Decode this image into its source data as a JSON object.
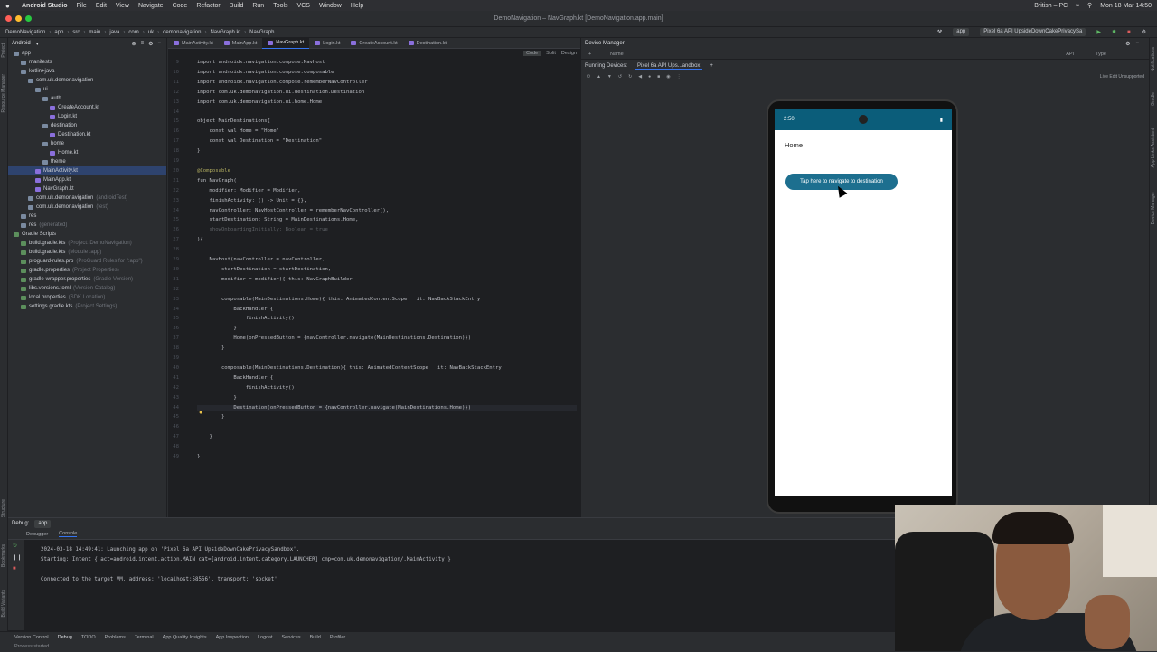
{
  "menubar": {
    "app_name": "Android Studio",
    "items": [
      "File",
      "Edit",
      "View",
      "Navigate",
      "Code",
      "Refactor",
      "Build",
      "Run",
      "Tools",
      "VCS",
      "Window",
      "Help"
    ],
    "input_source": "British – PC",
    "datetime": "Mon 18 Mar 14:50"
  },
  "window": {
    "title": "DemoNavigation – NavGraph.kt [DemoNavigation.app.main]"
  },
  "breadcrumb": [
    "DemoNavigation",
    "app",
    "src",
    "main",
    "java",
    "com",
    "uk",
    "demonavigation",
    "NavGraph.kt",
    "NavGraph"
  ],
  "run_config": {
    "module": "app",
    "device": "Pixel 6a API UpsideDownCakePrivacySa"
  },
  "project_panel": {
    "view_label": "Android",
    "tree": [
      {
        "label": "app",
        "indent": 0,
        "type": "folder"
      },
      {
        "label": "manifests",
        "indent": 1,
        "type": "folder"
      },
      {
        "label": "kotlin+java",
        "indent": 1,
        "type": "folder"
      },
      {
        "label": "com.uk.demonavigation",
        "indent": 2,
        "type": "folder"
      },
      {
        "label": "ui",
        "indent": 3,
        "type": "folder"
      },
      {
        "label": "auth",
        "indent": 4,
        "type": "folder"
      },
      {
        "label": "CreateAccount.kt",
        "indent": 5,
        "type": "kt"
      },
      {
        "label": "Login.kt",
        "indent": 5,
        "type": "kt"
      },
      {
        "label": "destination",
        "indent": 4,
        "type": "folder"
      },
      {
        "label": "Destination.kt",
        "indent": 5,
        "type": "kt"
      },
      {
        "label": "home",
        "indent": 4,
        "type": "folder"
      },
      {
        "label": "Home.kt",
        "indent": 5,
        "type": "kt"
      },
      {
        "label": "theme",
        "indent": 4,
        "type": "folder"
      },
      {
        "label": "MainActivity.kt",
        "indent": 3,
        "type": "kt",
        "selected": true
      },
      {
        "label": "MainApp.kt",
        "indent": 3,
        "type": "kt"
      },
      {
        "label": "NavGraph.kt",
        "indent": 3,
        "type": "kt"
      },
      {
        "label": "com.uk.demonavigation",
        "dim": "(androidTest)",
        "indent": 2,
        "type": "folder"
      },
      {
        "label": "com.uk.demonavigation",
        "dim": "(test)",
        "indent": 2,
        "type": "folder"
      },
      {
        "label": "res",
        "indent": 1,
        "type": "folder"
      },
      {
        "label": "res",
        "dim": "(generated)",
        "indent": 1,
        "type": "folder"
      },
      {
        "label": "Gradle Scripts",
        "indent": 0,
        "type": "gr"
      },
      {
        "label": "build.gradle.kts",
        "dim": "(Project: DemoNavigation)",
        "indent": 1,
        "type": "gr"
      },
      {
        "label": "build.gradle.kts",
        "dim": "(Module :app)",
        "indent": 1,
        "type": "gr"
      },
      {
        "label": "proguard-rules.pro",
        "dim": "(ProGuard Rules for \":app\")",
        "indent": 1,
        "type": "gr"
      },
      {
        "label": "gradle.properties",
        "dim": "(Project Properties)",
        "indent": 1,
        "type": "gr"
      },
      {
        "label": "gradle-wrapper.properties",
        "dim": "(Gradle Version)",
        "indent": 1,
        "type": "gr"
      },
      {
        "label": "libs.versions.toml",
        "dim": "(Version Catalog)",
        "indent": 1,
        "type": "gr"
      },
      {
        "label": "local.properties",
        "dim": "(SDK Location)",
        "indent": 1,
        "type": "gr"
      },
      {
        "label": "settings.gradle.kts",
        "dim": "(Project Settings)",
        "indent": 1,
        "type": "gr"
      }
    ]
  },
  "editor": {
    "tabs": [
      "MainActivity.kt",
      "MainApp.kt",
      "NavGraph.kt",
      "Login.kt",
      "CreateAccount.kt",
      "Destination.kt"
    ],
    "active_tab": "NavGraph.kt",
    "modes": [
      "Code",
      "Split",
      "Design"
    ],
    "lines": [
      {
        "n": "9",
        "text": "import androidx.navigation.compose.NavHost",
        "cls": ""
      },
      {
        "n": "10",
        "text": "import androidx.navigation.compose.composable",
        "cls": ""
      },
      {
        "n": "11",
        "text": "import androidx.navigation.compose.rememberNavController",
        "cls": ""
      },
      {
        "n": "12",
        "text": "import com.uk.demonavigation.ui.destination.Destination",
        "cls": ""
      },
      {
        "n": "13",
        "text": "import com.uk.demonavigation.ui.home.Home",
        "cls": ""
      },
      {
        "n": "14",
        "text": "",
        "cls": ""
      },
      {
        "n": "15",
        "text": "object MainDestinations{",
        "cls": ""
      },
      {
        "n": "16",
        "text": "    const val Home = \"Home\"",
        "cls": ""
      },
      {
        "n": "17",
        "text": "    const val Destination = \"Destination\"",
        "cls": ""
      },
      {
        "n": "18",
        "text": "}",
        "cls": ""
      },
      {
        "n": "19",
        "text": "",
        "cls": ""
      },
      {
        "n": "20",
        "text": "@Composable",
        "cls": "an"
      },
      {
        "n": "21",
        "text": "fun NavGraph(",
        "cls": ""
      },
      {
        "n": "22",
        "text": "    modifier: Modifier = Modifier,",
        "cls": ""
      },
      {
        "n": "23",
        "text": "    finishActivity: () -> Unit = {},",
        "cls": ""
      },
      {
        "n": "24",
        "text": "    navController: NavHostController = rememberNavController(),",
        "cls": ""
      },
      {
        "n": "25",
        "text": "    startDestination: String = MainDestinations.Home,",
        "cls": ""
      },
      {
        "n": "26",
        "text": "    showOnboardingInitially: Boolean = true",
        "cls": "hint"
      },
      {
        "n": "27",
        "text": "){",
        "cls": ""
      },
      {
        "n": "28",
        "text": "",
        "cls": ""
      },
      {
        "n": "29",
        "text": "    NavHost(navController = navController,",
        "cls": ""
      },
      {
        "n": "30",
        "text": "        startDestination = startDestination,",
        "cls": ""
      },
      {
        "n": "31",
        "text": "        modifier = modifier){ this: NavGraphBuilder",
        "cls": ""
      },
      {
        "n": "32",
        "text": "",
        "cls": ""
      },
      {
        "n": "33",
        "text": "        composable(MainDestinations.Home){ this: AnimatedContentScope   it: NavBackStackEntry",
        "cls": ""
      },
      {
        "n": "34",
        "text": "            BackHandler {",
        "cls": ""
      },
      {
        "n": "35",
        "text": "                finishActivity()",
        "cls": ""
      },
      {
        "n": "36",
        "text": "            }",
        "cls": ""
      },
      {
        "n": "37",
        "text": "            Home(onPressedButton = {navController.navigate(MainDestinations.Destination)})",
        "cls": ""
      },
      {
        "n": "38",
        "text": "        }",
        "cls": ""
      },
      {
        "n": "39",
        "text": "",
        "cls": ""
      },
      {
        "n": "40",
        "text": "        composable(MainDestinations.Destination){ this: AnimatedContentScope   it: NavBackStackEntry",
        "cls": ""
      },
      {
        "n": "41",
        "text": "            BackHandler {",
        "cls": ""
      },
      {
        "n": "42",
        "text": "                finishActivity()",
        "cls": ""
      },
      {
        "n": "43",
        "text": "            }",
        "cls": ""
      },
      {
        "n": "44",
        "text": "            Destination(onPressedButton = {navController.navigate(MainDestinations.Home)})",
        "cls": "cur"
      },
      {
        "n": "45",
        "text": "        }",
        "cls": ""
      },
      {
        "n": "46",
        "text": "",
        "cls": ""
      },
      {
        "n": "47",
        "text": "    }",
        "cls": ""
      },
      {
        "n": "48",
        "text": "",
        "cls": ""
      },
      {
        "n": "49",
        "text": "}",
        "cls": ""
      }
    ]
  },
  "device_manager": {
    "title": "Device Manager",
    "columns": {
      "name": "Name",
      "api": "API",
      "type": "Type"
    },
    "running_label": "Running Devices:",
    "running_tab": "Pixel 6a API Ups...andbox",
    "live_edit": "Live Edit Unsupported"
  },
  "phone": {
    "time": "2:50",
    "screen_title": "Home",
    "button_label": "Tap here to navigate to destination"
  },
  "debug": {
    "label": "Debug:",
    "config": "app",
    "tabs": [
      "Debugger",
      "Console"
    ],
    "active_tab": "Console",
    "console_lines": [
      "2024-03-18 14:49:41: Launching app on 'Pixel 6a API UpsideDownCakePrivacySandbox'.",
      "Starting: Intent { act=android.intent.action.MAIN cat=[android.intent.category.LAUNCHER] cmp=com.uk.demonavigation/.MainActivity }",
      "",
      "Connected to the target VM, address: 'localhost:58556', transport: 'socket'"
    ]
  },
  "bottom_tools": [
    "Version Control",
    "Debug",
    "TODO",
    "Problems",
    "Terminal",
    "App Quality Insights",
    "App Inspection",
    "Logcat",
    "Services",
    "Build",
    "Profiler"
  ],
  "status_text": "Process started",
  "left_tools": [
    "Project",
    "Resource Manager",
    "Structure",
    "Bookmarks",
    "Build Variants"
  ],
  "right_tools": [
    "Notifications",
    "Gradle",
    "App Links Assistant",
    "Device Manager"
  ]
}
